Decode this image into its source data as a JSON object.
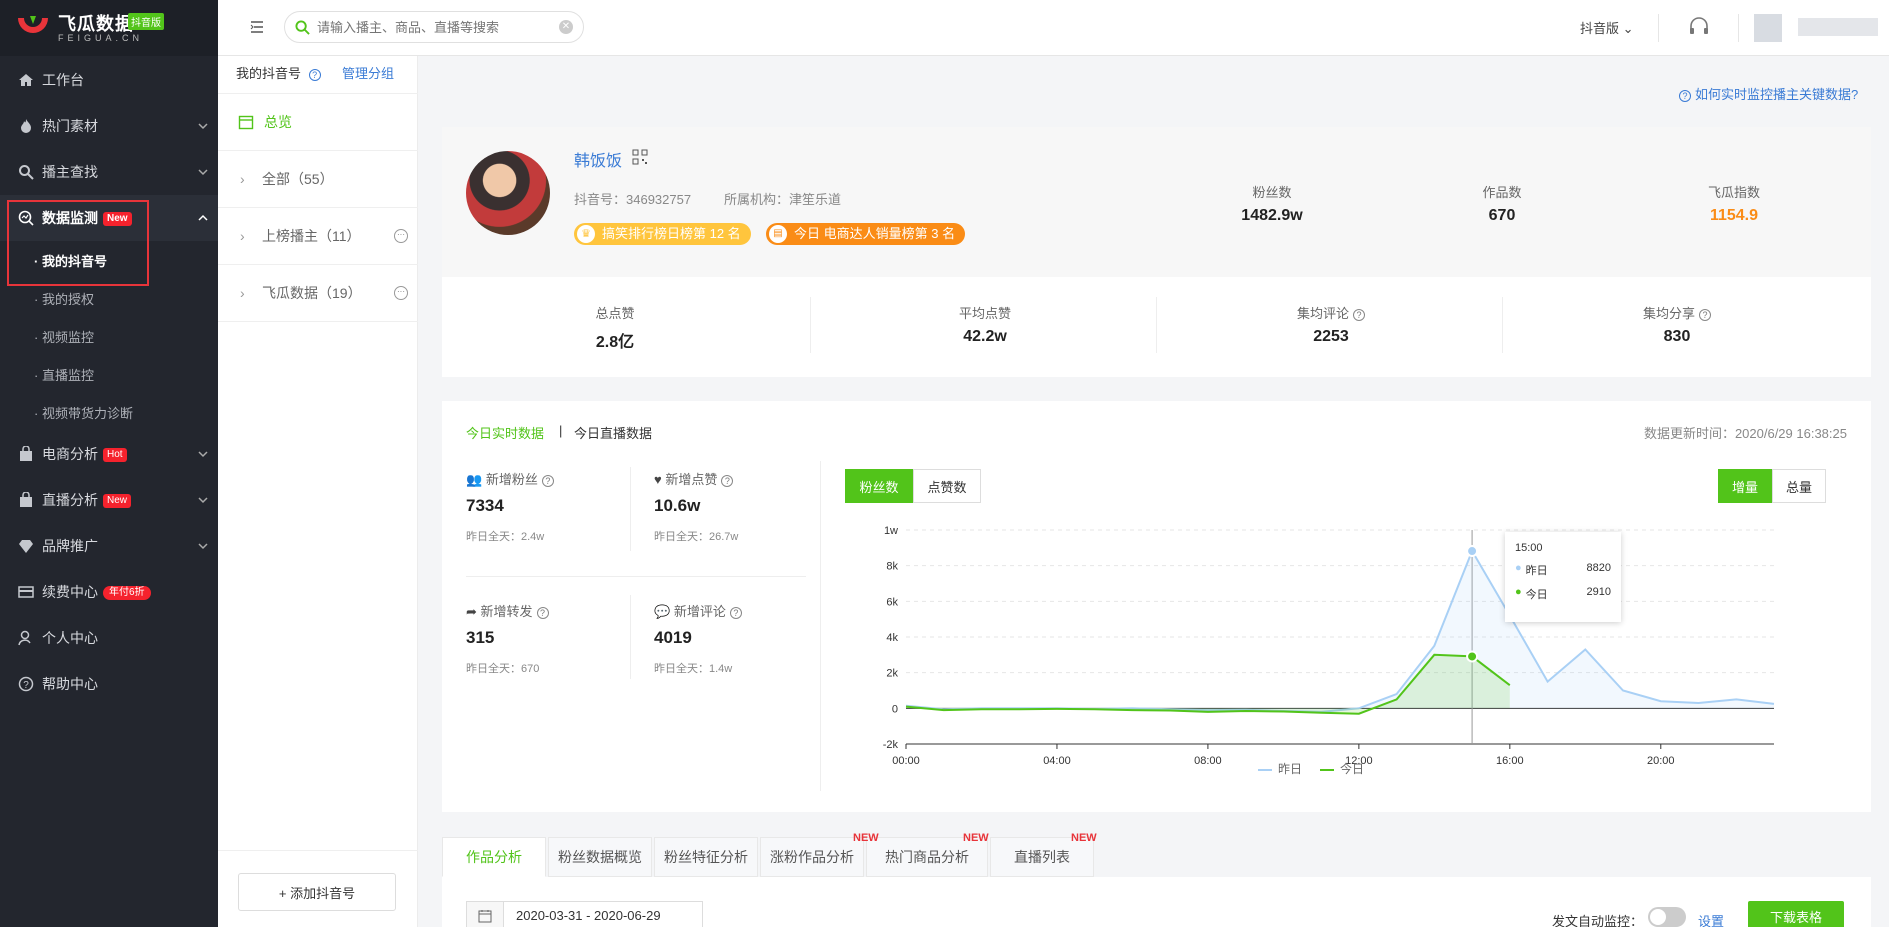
{
  "app": {
    "brand_cn": "飞瓜数据",
    "brand_en": "FEIGUA.CN",
    "brand_badge": "抖音版"
  },
  "sidebar": {
    "items": [
      {
        "label": "工作台",
        "icon": "home-icon"
      },
      {
        "label": "热门素材",
        "icon": "fire-icon"
      },
      {
        "label": "播主查找",
        "icon": "search-icon"
      },
      {
        "label": "数据监测",
        "icon": "monitor-icon",
        "tag": "New"
      },
      {
        "label": "电商分析",
        "icon": "bag-icon",
        "tag": "Hot"
      },
      {
        "label": "直播分析",
        "icon": "live-icon",
        "tag": "New"
      },
      {
        "label": "品牌推广",
        "icon": "diamond-icon"
      },
      {
        "label": "续费中心",
        "icon": "card-icon",
        "tag": "年付6折"
      },
      {
        "label": "个人中心",
        "icon": "user-icon"
      },
      {
        "label": "帮助中心",
        "icon": "help-icon"
      }
    ],
    "subitems": [
      "· 我的抖音号",
      "· 我的授权",
      "· 视频监控",
      "· 直播监控",
      "· 视频带货力诊断"
    ]
  },
  "topbar": {
    "search_placeholder": "请输入播主、商品、直播等搜索",
    "platform": "抖音版"
  },
  "col2": {
    "title": "我的抖音号",
    "manage": "管理分组",
    "overview": "总览",
    "groups": [
      {
        "name": "全部",
        "count": "（55）"
      },
      {
        "name": "上榜播主",
        "count": "（11）"
      },
      {
        "name": "飞瓜数据",
        "count": "（19）"
      }
    ],
    "add_button": "+ 添加抖音号"
  },
  "help_link": "如何实时监控播主关键数据?",
  "profile": {
    "name": "韩饭饭",
    "douyin_id": "抖音号：346932757",
    "org": "所属机构：津笙乐道",
    "badge1": "搞笑排行榜日榜第 12 名",
    "badge2": "今日 电商达人销量榜第 3 名",
    "stats": [
      {
        "label": "粉丝数",
        "value": "1482.9w"
      },
      {
        "label": "作品数",
        "value": "670"
      },
      {
        "label": "飞瓜指数",
        "value": "1154.9"
      }
    ],
    "stats2": [
      {
        "label": "总点赞",
        "value": "2.8亿"
      },
      {
        "label": "平均点赞",
        "value": "42.2w"
      },
      {
        "label": "集均评论",
        "value": "2253"
      },
      {
        "label": "集均分享",
        "value": "830"
      }
    ]
  },
  "realtime": {
    "tab_active": "今日实时数据",
    "tab_other": "今日直播数据",
    "updated": "数据更新时间：2020/6/29 16:38:25",
    "metrics": [
      {
        "label": "新增粉丝",
        "value": "7334",
        "yesterday": "昨日全天：2.4w"
      },
      {
        "label": "新增点赞",
        "value": "10.6w",
        "yesterday": "昨日全天：26.7w"
      },
      {
        "label": "新增转发",
        "value": "315",
        "yesterday": "昨日全天：670"
      },
      {
        "label": "新增评论",
        "value": "4019",
        "yesterday": "昨日全天：1.4w"
      }
    ],
    "toggle1": [
      "粉丝数",
      "点赞数"
    ],
    "toggle2": [
      "增量",
      "总量"
    ]
  },
  "chart_data": {
    "type": "line",
    "x_ticks": [
      "00:00",
      "04:00",
      "08:00",
      "12:00",
      "16:00",
      "20:00"
    ],
    "y_ticks": [
      "-2k",
      "0",
      "2k",
      "4k",
      "6k",
      "8k",
      "1w"
    ],
    "ylim": [
      -2000,
      10000
    ],
    "series": [
      {
        "name": "昨日",
        "color": "#a9d0f5",
        "x": [
          0,
          1,
          2,
          3,
          4,
          5,
          6,
          7,
          8,
          9,
          10,
          11,
          12,
          13,
          14,
          15,
          16,
          17,
          18,
          19,
          20,
          21,
          22,
          23
        ],
        "values": [
          150,
          -50,
          0,
          0,
          0,
          -30,
          0,
          -50,
          -100,
          -80,
          -150,
          -200,
          0,
          800,
          3500,
          8820,
          5200,
          1500,
          3300,
          1000,
          400,
          300,
          500,
          250
        ]
      },
      {
        "name": "今日",
        "color": "#52c41a",
        "x": [
          0,
          1,
          2,
          3,
          4,
          5,
          6,
          7,
          8,
          9,
          10,
          11,
          12,
          13,
          14,
          15,
          16
        ],
        "values": [
          100,
          -100,
          -50,
          -50,
          -30,
          -50,
          -100,
          -120,
          -200,
          -150,
          -180,
          -250,
          -300,
          500,
          3000,
          2910,
          1300
        ]
      }
    ],
    "tooltip": {
      "title": "15:00",
      "rows": [
        {
          "name": "昨日",
          "value": "8820"
        },
        {
          "name": "今日",
          "value": "2910"
        }
      ]
    },
    "legend": [
      "昨日",
      "今日"
    ]
  },
  "tabs": [
    {
      "label": "作品分析"
    },
    {
      "label": "粉丝数据概览"
    },
    {
      "label": "粉丝特征分析"
    },
    {
      "label": "涨粉作品分析",
      "badge": "NEW"
    },
    {
      "label": "热门商品分析",
      "badge": "NEW"
    },
    {
      "label": "直播列表",
      "badge": "NEW"
    }
  ],
  "bottom": {
    "date_range": "2020-03-31 - 2020-06-29",
    "auto_monitor": "发文自动监控：",
    "settings": "设置",
    "download": "下载表格"
  },
  "colors": {
    "accent": "#52c41a",
    "orange": "#fa8c16",
    "blue": "#3a7bd5",
    "sidebar": "#23262e"
  }
}
